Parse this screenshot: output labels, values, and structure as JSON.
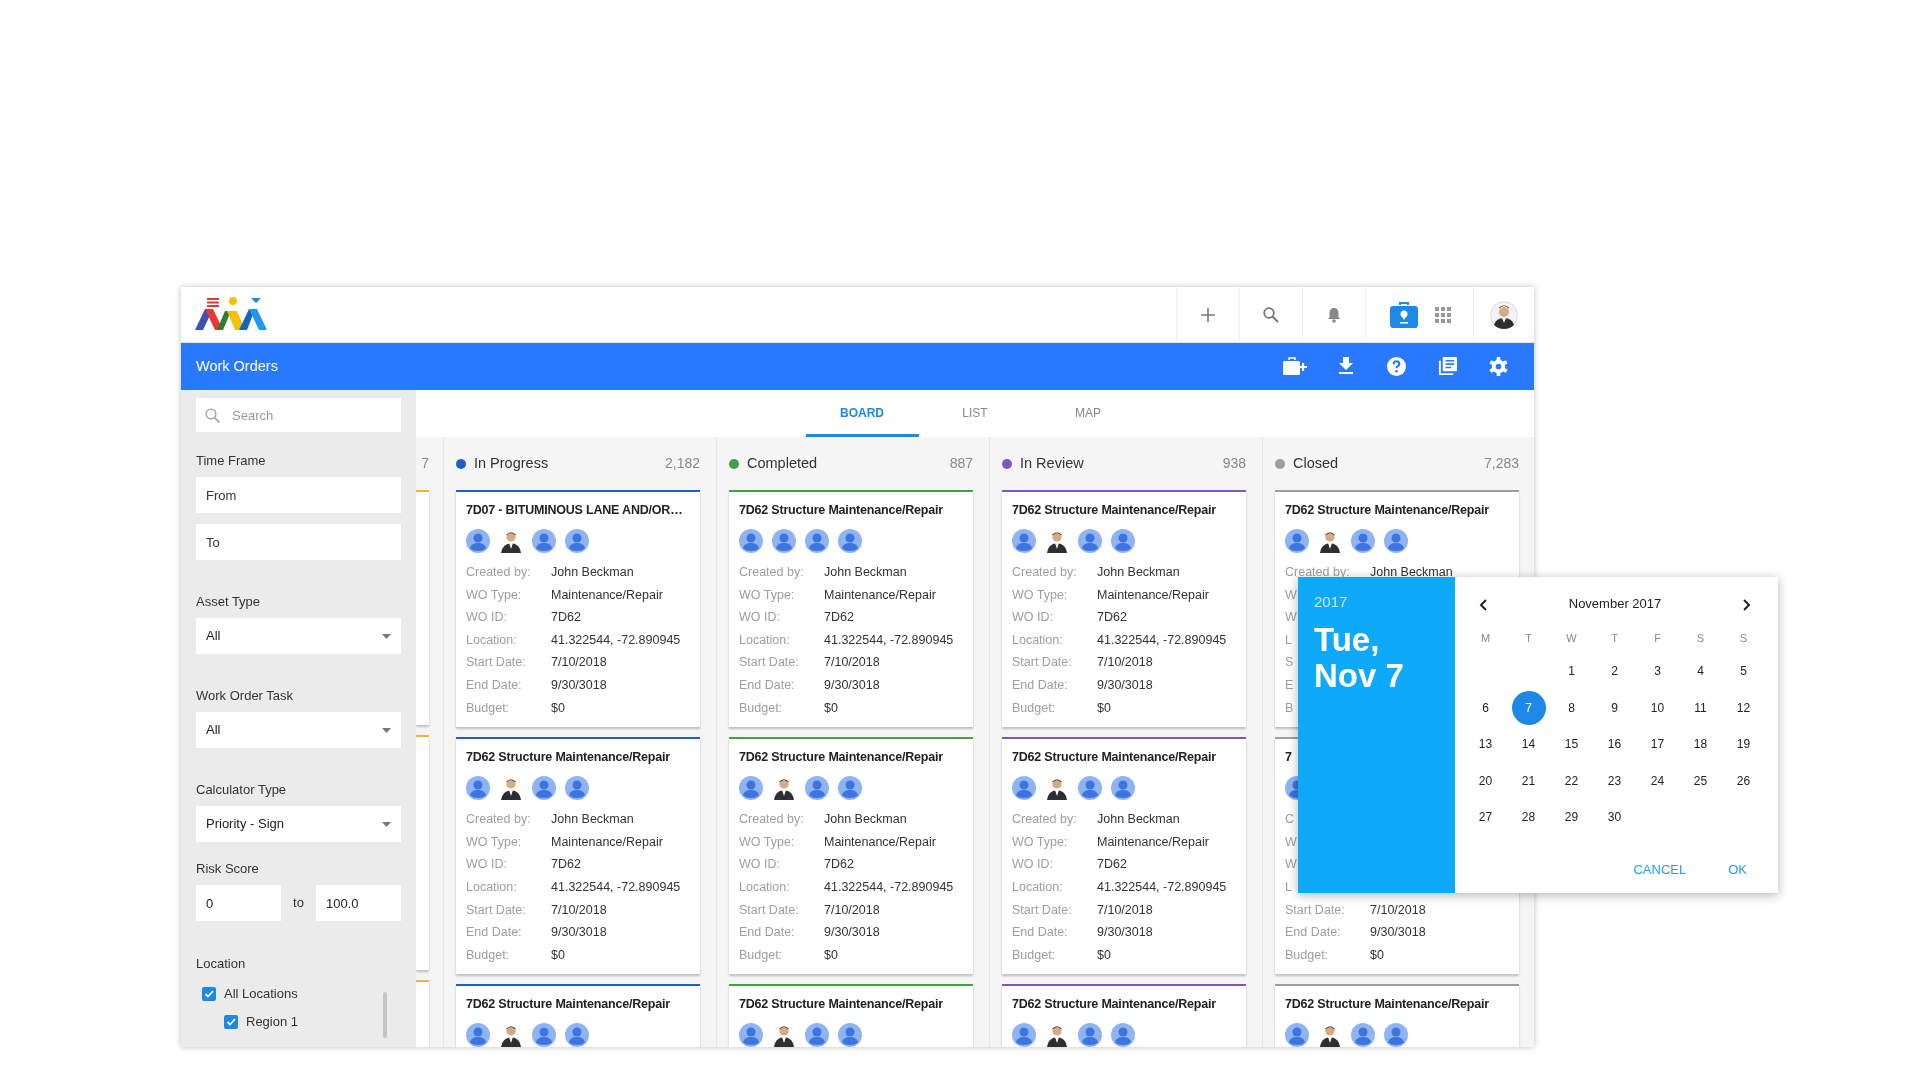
{
  "app": {
    "section_title": "Work Orders"
  },
  "filters": [
    {
      "kind": "search",
      "placeholder": "Search"
    },
    {
      "kind": "dates",
      "label": "Time Frame",
      "fields": [
        {
          "placeholder": "From"
        },
        {
          "placeholder": "To"
        }
      ]
    },
    {
      "kind": "select",
      "label": "Asset Type",
      "value": "All"
    },
    {
      "kind": "select",
      "label": "Work Order Task",
      "value": "All"
    },
    {
      "kind": "select",
      "label": "Calculator Type",
      "value": "Priority - Sign"
    },
    {
      "kind": "range",
      "label": "Risk Score",
      "min": "0",
      "joiner": "to",
      "max": "100.0"
    },
    {
      "kind": "checklist",
      "label": "Location",
      "items": [
        {
          "label": "All Locations",
          "checked": true,
          "children": [
            {
              "label": "Region 1",
              "checked": true
            }
          ]
        }
      ]
    }
  ],
  "tabs": [
    {
      "label": "BOARD",
      "selected": true
    },
    {
      "label": "LIST",
      "selected": false
    },
    {
      "label": "MAP",
      "selected": false
    }
  ],
  "columns": [
    {
      "kind": "partial",
      "count": "7",
      "color": "#f2b33d",
      "cards": [
        {
          "kind": "stub"
        },
        {
          "kind": "stub"
        },
        {
          "kind": "stub"
        }
      ]
    },
    {
      "kind": "full",
      "title": "In Progress",
      "count": "2,182",
      "color": "#1e5fc8",
      "cards": [
        {
          "title": "7D07 - BITUMINOUS LANE AND/OR…",
          "avatars": [
            {
              "kind": "generic"
            },
            {
              "kind": "photo"
            },
            {
              "kind": "generic"
            },
            {
              "kind": "generic"
            }
          ],
          "fields": [
            {
              "label": "Created by:",
              "value": "John Beckman"
            },
            {
              "label": "WO Type:",
              "value": "Maintenance/Repair"
            },
            {
              "label": "WO ID:",
              "value": "7D62"
            },
            {
              "label": "Location:",
              "value": "41.322544, -72.890945"
            },
            {
              "label": "Start Date:",
              "value": "7/10/2018"
            },
            {
              "label": "End Date:",
              "value": "9/30/3018"
            },
            {
              "label": "Budget:",
              "value": "$0"
            }
          ]
        },
        {
          "title": "7D62 Structure Maintenance/Repair",
          "avatars": [
            {
              "kind": "generic"
            },
            {
              "kind": "photo"
            },
            {
              "kind": "generic"
            },
            {
              "kind": "generic"
            }
          ],
          "fields": [
            {
              "label": "Created by:",
              "value": "John Beckman"
            },
            {
              "label": "WO Type:",
              "value": "Maintenance/Repair"
            },
            {
              "label": "WO ID:",
              "value": "7D62"
            },
            {
              "label": "Location:",
              "value": "41.322544, -72.890945"
            },
            {
              "label": "Start Date:",
              "value": "7/10/2018"
            },
            {
              "label": "End Date:",
              "value": "9/30/3018"
            },
            {
              "label": "Budget:",
              "value": "$0"
            }
          ]
        },
        {
          "title": "7D62 Structure Maintenance/Repair",
          "avatars": [
            {
              "kind": "generic"
            },
            {
              "kind": "photo"
            },
            {
              "kind": "generic"
            },
            {
              "kind": "generic"
            }
          ]
        }
      ]
    },
    {
      "kind": "full",
      "title": "Completed",
      "count": "887",
      "color": "#43a047",
      "cards": [
        {
          "title": "7D62 Structure Maintenance/Repair",
          "avatars": [
            {
              "kind": "generic"
            },
            {
              "kind": "generic"
            },
            {
              "kind": "generic"
            },
            {
              "kind": "generic"
            }
          ],
          "fields": [
            {
              "label": "Created by:",
              "value": "John Beckman"
            },
            {
              "label": "WO Type:",
              "value": "Maintenance/Repair"
            },
            {
              "label": "WO ID:",
              "value": "7D62"
            },
            {
              "label": "Location:",
              "value": "41.322544, -72.890945"
            },
            {
              "label": "Start Date:",
              "value": "7/10/2018"
            },
            {
              "label": "End Date:",
              "value": "9/30/3018"
            },
            {
              "label": "Budget:",
              "value": "$0"
            }
          ]
        },
        {
          "title": "7D62 Structure Maintenance/Repair",
          "avatars": [
            {
              "kind": "generic"
            },
            {
              "kind": "photo"
            },
            {
              "kind": "generic"
            },
            {
              "kind": "generic"
            }
          ],
          "fields": [
            {
              "label": "Created by:",
              "value": "John Beckman"
            },
            {
              "label": "WO Type:",
              "value": "Maintenance/Repair"
            },
            {
              "label": "WO ID:",
              "value": "7D62"
            },
            {
              "label": "Location:",
              "value": "41.322544, -72.890945"
            },
            {
              "label": "Start Date:",
              "value": "7/10/2018"
            },
            {
              "label": "End Date:",
              "value": "9/30/3018"
            },
            {
              "label": "Budget:",
              "value": "$0"
            }
          ]
        },
        {
          "title": "7D62 Structure Maintenance/Repair",
          "avatars": [
            {
              "kind": "generic"
            },
            {
              "kind": "photo"
            },
            {
              "kind": "generic"
            },
            {
              "kind": "generic"
            }
          ]
        }
      ]
    },
    {
      "kind": "full",
      "title": "In Review",
      "count": "938",
      "color": "#7e57c2",
      "cards": [
        {
          "title": "7D62 Structure Maintenance/Repair",
          "avatars": [
            {
              "kind": "generic"
            },
            {
              "kind": "photo"
            },
            {
              "kind": "generic"
            },
            {
              "kind": "generic"
            }
          ],
          "fields": [
            {
              "label": "Created by:",
              "value": "John Beckman"
            },
            {
              "label": "WO Type:",
              "value": "Maintenance/Repair"
            },
            {
              "label": "WO ID:",
              "value": "7D62"
            },
            {
              "label": "Location:",
              "value": "41.322544, -72.890945"
            },
            {
              "label": "Start Date:",
              "value": "7/10/2018"
            },
            {
              "label": "End Date:",
              "value": "9/30/3018"
            },
            {
              "label": "Budget:",
              "value": "$0"
            }
          ]
        },
        {
          "title": "7D62 Structure Maintenance/Repair",
          "avatars": [
            {
              "kind": "generic"
            },
            {
              "kind": "photo"
            },
            {
              "kind": "generic"
            },
            {
              "kind": "generic"
            }
          ],
          "fields": [
            {
              "label": "Created by:",
              "value": "John Beckman"
            },
            {
              "label": "WO Type:",
              "value": "Maintenance/Repair"
            },
            {
              "label": "WO ID:",
              "value": "7D62"
            },
            {
              "label": "Location:",
              "value": "41.322544, -72.890945"
            },
            {
              "label": "Start Date:",
              "value": "7/10/2018"
            },
            {
              "label": "End Date:",
              "value": "9/30/3018"
            },
            {
              "label": "Budget:",
              "value": "$0"
            }
          ]
        },
        {
          "title": "7D62 Structure Maintenance/Repair",
          "avatars": [
            {
              "kind": "generic"
            },
            {
              "kind": "photo"
            },
            {
              "kind": "generic"
            },
            {
              "kind": "generic"
            }
          ]
        }
      ]
    },
    {
      "kind": "full",
      "title": "Closed",
      "count": "7,283",
      "color": "#9e9e9e",
      "cards": [
        {
          "title": "7D62 Structure Maintenance/Repair",
          "avatars": [
            {
              "kind": "generic"
            },
            {
              "kind": "photo"
            },
            {
              "kind": "generic"
            },
            {
              "kind": "generic"
            }
          ],
          "fields": [
            {
              "label": "Created by:",
              "value": "John Beckman"
            },
            {
              "label": "W"
            },
            {
              "label": "W"
            },
            {
              "label": "L"
            },
            {
              "label": "S"
            },
            {
              "label": "E"
            },
            {
              "label": "B"
            }
          ]
        },
        {
          "title": "7",
          "avatars": [
            {
              "kind": "generic"
            }
          ],
          "fields": [
            {
              "label": "C"
            },
            {
              "label": "W"
            },
            {
              "label": "W"
            },
            {
              "label": "L"
            },
            {
              "label": "Start Date:",
              "value": "7/10/2018"
            },
            {
              "label": "End Date:",
              "value": "9/30/3018"
            },
            {
              "label": "Budget:",
              "value": "$0"
            }
          ]
        },
        {
          "title": "7D62 Structure Maintenance/Repair",
          "avatars": [
            {
              "kind": "generic"
            },
            {
              "kind": "photo"
            },
            {
              "kind": "generic"
            },
            {
              "kind": "generic"
            }
          ]
        }
      ]
    }
  ],
  "date_picker": {
    "year": "2017",
    "date_line_1": "Tue,",
    "date_line_2": "Nov 7",
    "month": "November 2017",
    "weekdays": [
      "M",
      "T",
      "W",
      "T",
      "F",
      "S",
      "S"
    ],
    "weeks": [
      {
        "kind": "first",
        "days": [
          {
            "day": "1",
            "selected": false
          },
          {
            "day": "2",
            "selected": false
          },
          {
            "day": "3",
            "selected": false
          },
          {
            "day": "4",
            "selected": false
          },
          {
            "day": "5",
            "selected": false
          }
        ]
      },
      {
        "kind": "full",
        "days": [
          {
            "day": "6",
            "selected": false
          },
          {
            "day": "7",
            "selected": true
          },
          {
            "day": "8",
            "selected": false
          },
          {
            "day": "9",
            "selected": false
          },
          {
            "day": "10",
            "selected": false
          },
          {
            "day": "11",
            "selected": false
          },
          {
            "day": "12",
            "selected": false
          }
        ]
      },
      {
        "kind": "full",
        "days": [
          {
            "day": "13",
            "selected": false
          },
          {
            "day": "14",
            "selected": false
          },
          {
            "day": "15",
            "selected": false
          },
          {
            "day": "16",
            "selected": false
          },
          {
            "day": "17",
            "selected": false
          },
          {
            "day": "18",
            "selected": false
          },
          {
            "day": "19",
            "selected": false
          }
        ]
      },
      {
        "kind": "full",
        "days": [
          {
            "day": "20",
            "selected": false
          },
          {
            "day": "21",
            "selected": false
          },
          {
            "day": "22",
            "selected": false
          },
          {
            "day": "23",
            "selected": false
          },
          {
            "day": "24",
            "selected": false
          },
          {
            "day": "25",
            "selected": false
          },
          {
            "day": "26",
            "selected": false
          }
        ]
      },
      {
        "kind": "last",
        "days": [
          {
            "day": "27",
            "selected": false
          },
          {
            "day": "28",
            "selected": false
          },
          {
            "day": "29",
            "selected": false
          },
          {
            "day": "30",
            "selected": false
          }
        ]
      }
    ],
    "buttons": [
      "CANCEL",
      "OK"
    ]
  }
}
